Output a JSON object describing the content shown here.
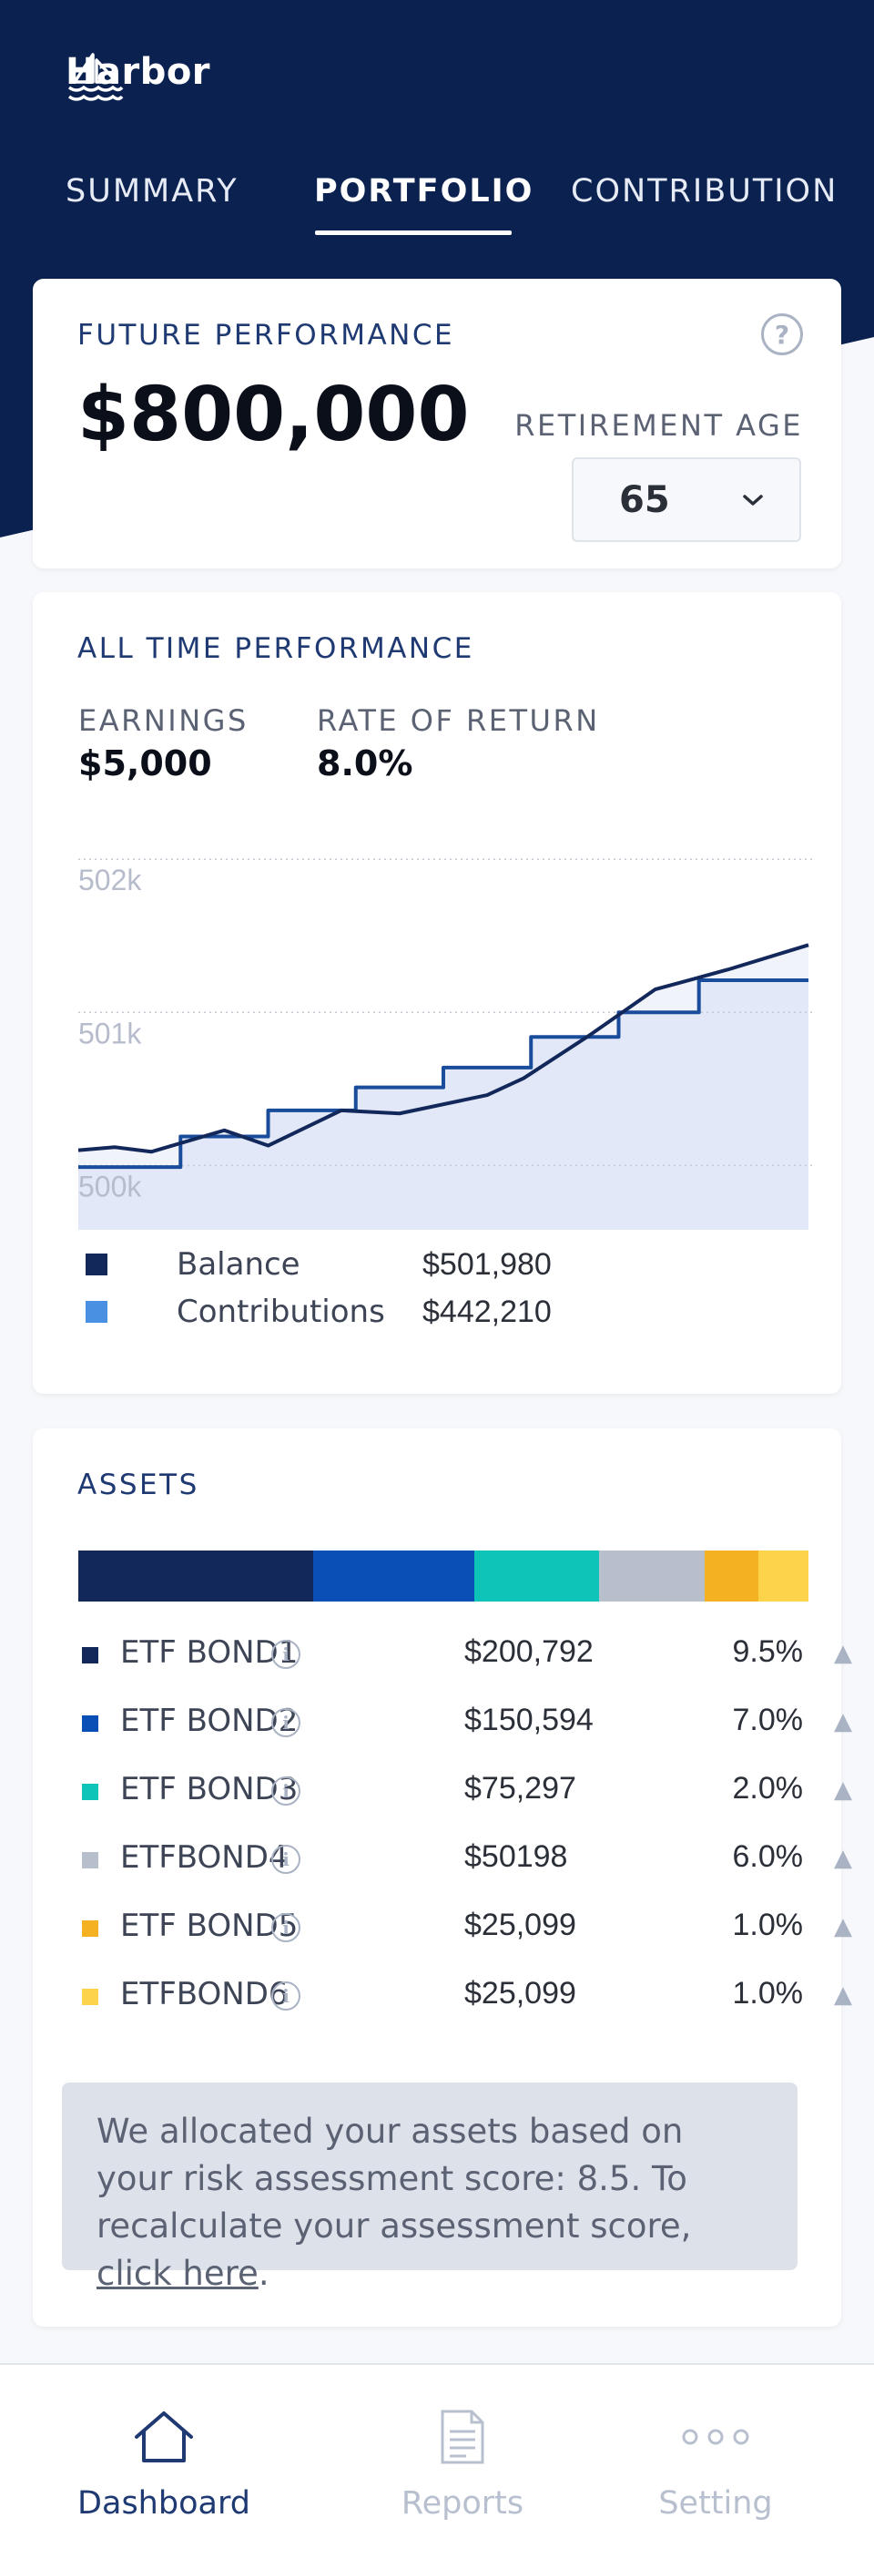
{
  "app": {
    "name": "Harbor"
  },
  "tabs": [
    {
      "label": "SUMMARY",
      "active": false
    },
    {
      "label": "PORTFOLIO",
      "active": true
    },
    {
      "label": "CONTRIBUTION",
      "active": false
    }
  ],
  "future_performance": {
    "title": "FUTURE PERFORMANCE",
    "amount": "$800,000",
    "help_icon": "question-circle-icon",
    "retirement_age_label": "RETIREMENT AGE",
    "retirement_age_value": "65"
  },
  "all_time_performance": {
    "title": "ALL TIME PERFORMANCE",
    "earnings_label": "EARNINGS",
    "earnings_value": "$5,000",
    "rate_label": "RATE OF RETURN",
    "rate_value": "8.0%",
    "legend": [
      {
        "name": "Balance",
        "value": "$501,980",
        "color": "#13285a"
      },
      {
        "name": "Contributions",
        "value": "$442,210",
        "color": "#4a90e2"
      }
    ]
  },
  "chart_data": {
    "type": "line",
    "title": "",
    "xlabel": "",
    "ylabel": "",
    "y_tick_labels": [
      "502k",
      "501k",
      "500k"
    ],
    "y_ticks": [
      502000,
      501000,
      500000
    ],
    "ylim": [
      499580,
      502150
    ],
    "grid": true,
    "legend_position": "bottom",
    "x": [
      0,
      1,
      2,
      3,
      4,
      5,
      6,
      7,
      8,
      9,
      10,
      11,
      12
    ],
    "series": [
      {
        "name": "Balance",
        "step": false,
        "x": [
          0,
          0.05,
          0.1,
          0.2,
          0.26,
          0.36,
          0.44,
          0.56,
          0.61,
          0.7,
          0.79,
          0.89,
          1.0
        ],
        "values": [
          500100,
          500120,
          500090,
          500230,
          500130,
          500360,
          500340,
          500460,
          500570,
          500850,
          501150,
          501280,
          501440
        ]
      },
      {
        "name": "Contributions",
        "step": true,
        "x": [
          0,
          0.14,
          0.26,
          0.38,
          0.5,
          0.62,
          0.74,
          0.85,
          1.0
        ],
        "values": [
          499990,
          500190,
          500360,
          500510,
          500640,
          500840,
          501000,
          501210,
          501210
        ]
      }
    ],
    "colors": {
      "balance": "#13285a",
      "contributions": "#1a4c9c",
      "fill": "#e2e8f7",
      "grid": "#c4c9d4"
    }
  },
  "assets": {
    "title": "ASSETS",
    "items": [
      {
        "name": "ETF BOND1",
        "amount": "$200,792",
        "pct": "9.5%",
        "color": "#13285a",
        "share": 0.322,
        "trend": "▲"
      },
      {
        "name": "ETF BOND2",
        "amount": "$150,594",
        "pct": "7.0%",
        "color": "#0a4fb5",
        "share": 0.221,
        "trend": "▲"
      },
      {
        "name": "ETF BOND3",
        "amount": "$75,297",
        "pct": "2.0%",
        "color": "#0ec4b8",
        "share": 0.17,
        "trend": "▲"
      },
      {
        "name": "ETFBOND4",
        "amount": "$50198",
        "pct": "6.0%",
        "color": "#b7bfcc",
        "share": 0.145,
        "trend": "▲"
      },
      {
        "name": "ETF BOND5",
        "amount": "$25,099",
        "pct": "1.0%",
        "color": "#f4b223",
        "share": 0.074,
        "trend": "▲"
      },
      {
        "name": "ETFBOND6",
        "amount": "$25,099",
        "pct": "1.0%",
        "color": "#fdd34b",
        "share": 0.068,
        "trend": "▲"
      }
    ],
    "notice_text": "We allocated your assets based on your risk assessment score: 8.5. To recalculate your assessment score, ",
    "notice_link": "click here",
    "notice_end": "."
  },
  "bottom_nav": [
    {
      "label": "Dashboard",
      "icon": "home-icon",
      "active": true
    },
    {
      "label": "Reports",
      "icon": "document-icon",
      "active": false
    },
    {
      "label": "Setting",
      "icon": "more-dots-icon",
      "active": false
    }
  ],
  "colors": {
    "navy": "#0b2150",
    "accent": "#1f3a72",
    "muted": "#aab3c4"
  }
}
